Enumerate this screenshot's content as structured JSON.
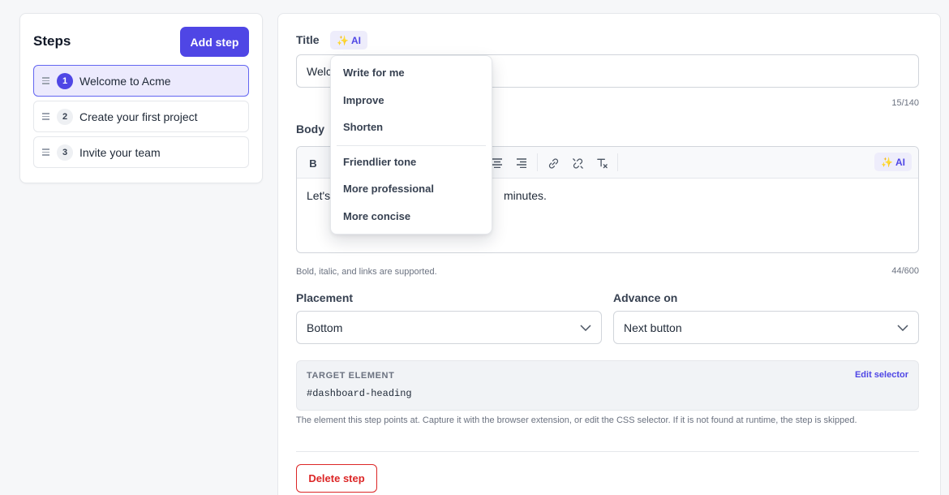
{
  "steps_panel": {
    "title": "Steps",
    "add_button": "Add step",
    "items": [
      {
        "number": "1",
        "label": "Welcome to Acme",
        "active": true
      },
      {
        "number": "2",
        "label": "Create your first project",
        "active": false
      },
      {
        "number": "3",
        "label": "Invite your team",
        "active": false
      }
    ]
  },
  "editor": {
    "title_label": "Title",
    "ai_label": "AI",
    "title_value": "Welcome to Acme",
    "title_counter": "15/140",
    "body_label": "Body",
    "toolbar": {
      "bold": "B",
      "ai_label": "AI",
      "icons": [
        "bold-icon",
        "align-center-icon",
        "align-right-icon",
        "link-icon",
        "unlink-icon",
        "clear-format-icon"
      ]
    },
    "body_value_start": "Let's",
    "body_value_end": "minutes.",
    "body_hint": "Bold, italic, and links are supported.",
    "body_counter": "44/600",
    "placement_label": "Placement",
    "placement_value": "Bottom",
    "advance_label": "Advance on",
    "advance_value": "Next button",
    "target": {
      "label": "TARGET ELEMENT",
      "edit_link": "Edit selector",
      "selector": "#dashboard-heading",
      "hint": "The element this step points at. Capture it with the browser extension, or edit the CSS selector. If it is not found at runtime, the step is skipped."
    },
    "delete_button": "Delete step"
  },
  "ai_menu": {
    "group1": [
      "Write for me",
      "Improve",
      "Shorten"
    ],
    "group2": [
      "Friendlier tone",
      "More professional",
      "More concise"
    ]
  },
  "colors": {
    "accent": "#4f46e5",
    "danger": "#dc2626",
    "active_step_bg": "#eceafd"
  }
}
